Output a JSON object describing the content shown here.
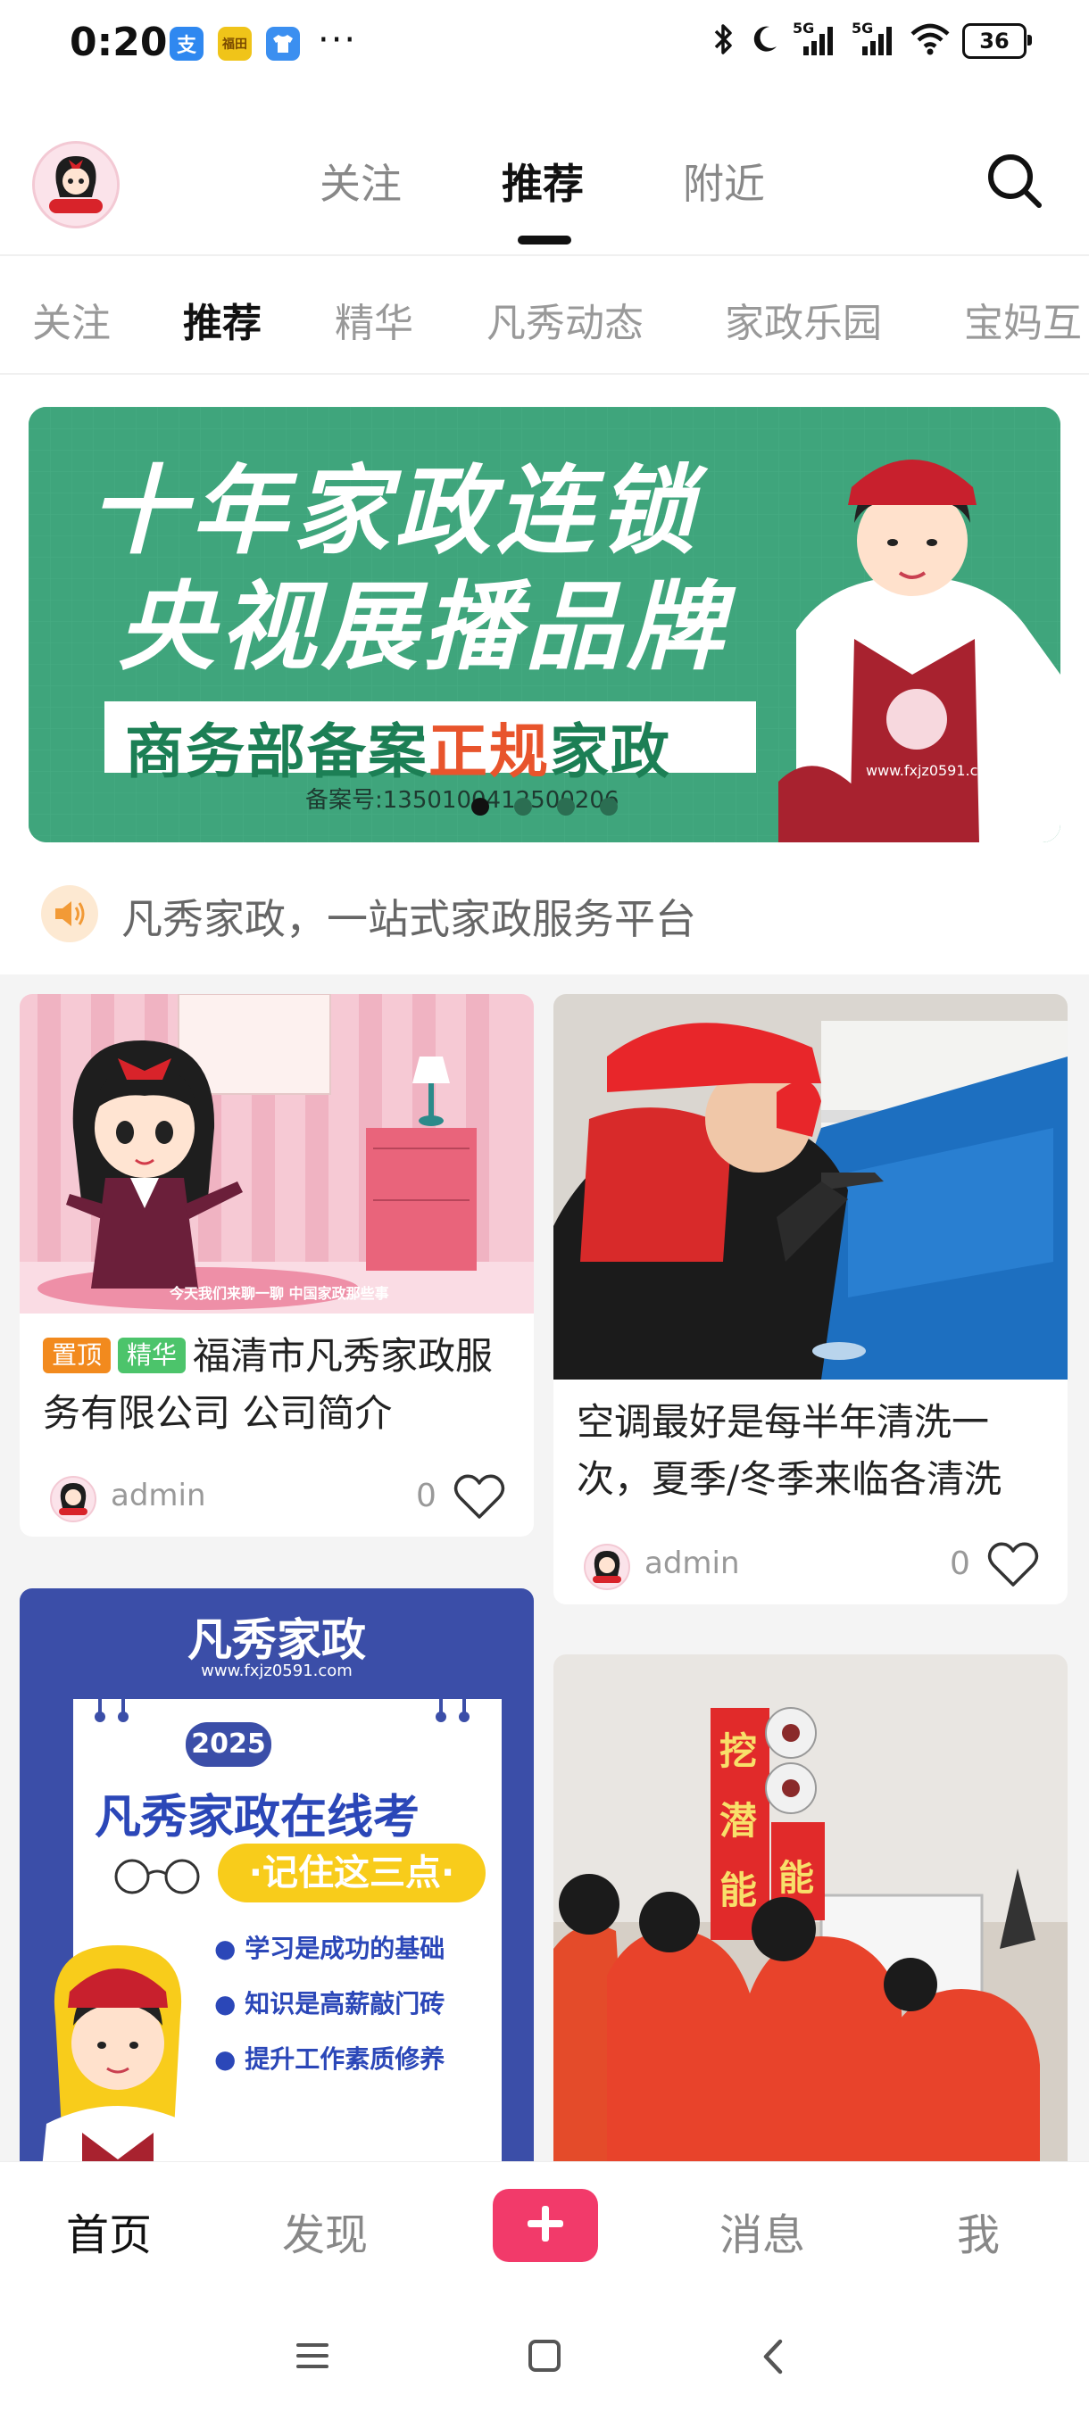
{
  "status_bar": {
    "time": "0:20",
    "apps": [
      {
        "icon": "alipay-icon",
        "glyph": "支",
        "color": "#2f88f0"
      },
      {
        "icon": "app-icon",
        "glyph": "福田",
        "color": "#f0c419"
      },
      {
        "icon": "tshirt-app-icon",
        "glyph": "👕",
        "color": "#3b8ff0"
      }
    ],
    "more": "···",
    "signal_1": "5G",
    "signal_2": "5G",
    "battery": "36"
  },
  "header": {
    "tabs": [
      "关注",
      "推荐",
      "附近"
    ],
    "active_tab": "推荐"
  },
  "categories": {
    "items": [
      "关注",
      "推荐",
      "精华",
      "凡秀动态",
      "家政乐园",
      "宝妈互"
    ],
    "active": "推荐"
  },
  "banner": {
    "line1": "十年家政连锁",
    "line2": "央视展播品牌",
    "strip_part1": "商务部备案",
    "strip_highlight": "正规",
    "strip_part2": "家政",
    "record": "备案号:13501004125002",
    "record_tail": "06",
    "apron_text": "www.fxjz0591.com",
    "dots": 4,
    "active_dot": 0
  },
  "announcement": {
    "icon": "speaker-icon",
    "text": "凡秀家政，一站式家政服务平台"
  },
  "posts": [
    {
      "tags": [
        {
          "label": "置顶",
          "color": "#f28a1e"
        },
        {
          "label": "精华",
          "color": "#4cc46b"
        }
      ],
      "title": "福清市凡秀家政服务有限公司 公司简介",
      "image_caption": "今天我们来聊一聊 中国家政那些事",
      "author": "admin",
      "likes": "0"
    },
    {
      "tags": [],
      "title": "空调最好是每半年清洗一次，夏季/冬季来临各清洗",
      "author": "admin",
      "likes": "0"
    },
    {
      "poster_title": "凡秀家政",
      "poster_url": "www.fxjz0591.com",
      "poster_year": "2025",
      "poster_heading": "凡秀家政在线考",
      "poster_pill": "·记住这三点·",
      "poster_points": [
        "学习是成功的基础",
        "知识是高薪敲门砖",
        "提升工作素质修养"
      ]
    },
    {
      "banner_chars_left": [
        "挖",
        "潜",
        "能"
      ],
      "banner_chars_right": [
        "能"
      ]
    }
  ],
  "bottom_nav": {
    "items": [
      "首页",
      "发现",
      "消息",
      "我"
    ],
    "active": "首页",
    "plus": "+"
  }
}
